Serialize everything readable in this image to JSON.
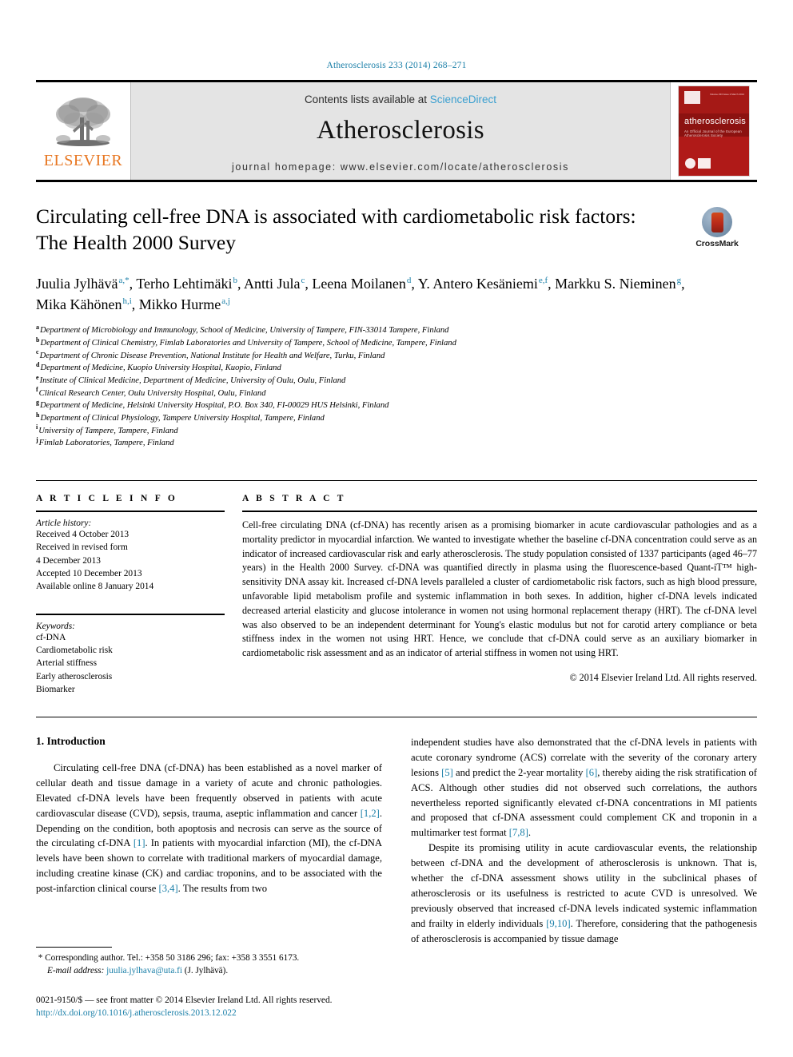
{
  "running_head": "Atherosclerosis 233 (2014) 268–271",
  "masthead": {
    "publisher_logo_label": "ELSEVIER",
    "contents_prefix": "Contents lists available at ",
    "contents_link": "ScienceDirect",
    "journal_name": "Atherosclerosis",
    "homepage": "journal homepage: www.elsevier.com/locate/atherosclerosis",
    "cover": {
      "title": "atherosclerosis",
      "subtitle": "An Official Journal of the European Atherosclerosis Society",
      "top_meta": "Volume 233  Issue 2  March 2014"
    }
  },
  "article": {
    "title": "Circulating cell-free DNA is associated with cardiometabolic risk factors: The Health 2000 Survey",
    "crossmark_label": "CrossMark",
    "authors": [
      {
        "name": "Juulia Jylhävä",
        "marks": "a,*",
        "sep": ", "
      },
      {
        "name": "Terho Lehtimäki",
        "marks": "b",
        "sep": ", "
      },
      {
        "name": "Antti Jula",
        "marks": "c",
        "sep": ", "
      },
      {
        "name": "Leena Moilanen",
        "marks": "d",
        "sep": ", "
      },
      {
        "name": "Y. Antero Kesäniemi",
        "marks": "e,f",
        "sep": ", "
      },
      {
        "name": "Markku S. Nieminen",
        "marks": "g",
        "sep": ", "
      },
      {
        "name": "Mika Kähönen",
        "marks": "h,i",
        "sep": ", "
      },
      {
        "name": "Mikko Hurme",
        "marks": "a,j",
        "sep": ""
      }
    ],
    "affiliations": [
      {
        "mark": "a",
        "text": "Department of Microbiology and Immunology, School of Medicine, University of Tampere, FIN-33014 Tampere, Finland"
      },
      {
        "mark": "b",
        "text": "Department of Clinical Chemistry, Fimlab Laboratories and University of Tampere, School of Medicine, Tampere, Finland"
      },
      {
        "mark": "c",
        "text": "Department of Chronic Disease Prevention, National Institute for Health and Welfare, Turku, Finland"
      },
      {
        "mark": "d",
        "text": "Department of Medicine, Kuopio University Hospital, Kuopio, Finland"
      },
      {
        "mark": "e",
        "text": "Institute of Clinical Medicine, Department of Medicine, University of Oulu, Oulu, Finland"
      },
      {
        "mark": "f",
        "text": "Clinical Research Center, Oulu University Hospital, Oulu, Finland"
      },
      {
        "mark": "g",
        "text": "Department of Medicine, Helsinki University Hospital, P.O. Box 340, FI-00029 HUS Helsinki, Finland"
      },
      {
        "mark": "h",
        "text": "Department of Clinical Physiology, Tampere University Hospital, Tampere, Finland"
      },
      {
        "mark": "i",
        "text": "University of Tampere, Tampere, Finland"
      },
      {
        "mark": "j",
        "text": "Fimlab Laboratories, Tampere, Finland"
      }
    ]
  },
  "article_info": {
    "heading": "A R T I C L E   I N F O",
    "history_label": "Article history:",
    "history": [
      "Received 4 October 2013",
      "Received in revised form",
      "4 December 2013",
      "Accepted 10 December 2013",
      "Available online 8 January 2014"
    ],
    "keywords_label": "Keywords:",
    "keywords": [
      "cf-DNA",
      "Cardiometabolic risk",
      "Arterial stiffness",
      "Early atherosclerosis",
      "Biomarker"
    ]
  },
  "abstract": {
    "heading": "A B S T R A C T",
    "text": "Cell-free circulating DNA (cf-DNA) has recently arisen as a promising biomarker in acute cardiovascular pathologies and as a mortality predictor in myocardial infarction. We wanted to investigate whether the baseline cf-DNA concentration could serve as an indicator of increased cardiovascular risk and early atherosclerosis. The study population consisted of 1337 participants (aged 46–77 years) in the Health 2000 Survey. cf-DNA was quantified directly in plasma using the fluorescence-based Quant-iT™ high-sensitivity DNA assay kit. Increased cf-DNA levels paralleled a cluster of cardiometabolic risk factors, such as high blood pressure, unfavorable lipid metabolism profile and systemic inflammation in both sexes. In addition, higher cf-DNA levels indicated decreased arterial elasticity and glucose intolerance in women not using hormonal replacement therapy (HRT). The cf-DNA level was also observed to be an independent determinant for Young's elastic modulus but not for carotid artery compliance or beta stiffness index in the women not using HRT. Hence, we conclude that cf-DNA could serve as an auxiliary biomarker in cardiometabolic risk assessment and as an indicator of arterial stiffness in women not using HRT.",
    "copyright": "© 2014 Elsevier Ireland Ltd. All rights reserved."
  },
  "introduction": {
    "section_title": "1.  Introduction",
    "left_paragraph_1": "Circulating cell-free DNA (cf-DNA) has been established as a novel marker of cellular death and tissue damage in a variety of acute and chronic pathologies. Elevated cf-DNA levels have been frequently observed in patients with acute cardiovascular disease (CVD), sepsis, trauma, aseptic inflammation and cancer ",
    "left_cite_1": "[1,2]",
    "left_paragraph_2": ". Depending on the condition, both apoptosis and necrosis can serve as the source of the circulating cf-DNA ",
    "left_cite_2": "[1]",
    "left_paragraph_3": ". In patients with myocardial infarction (MI), the cf-DNA levels have been shown to correlate with traditional markers of myocardial damage, including creatine kinase (CK) and cardiac troponins, and to be associated with the post-infarction clinical course ",
    "left_cite_3": "[3,4]",
    "left_paragraph_4": ". The results from two",
    "right_paragraph_1": "independent studies have also demonstrated that the cf-DNA levels in patients with acute coronary syndrome (ACS) correlate with the severity of the coronary artery lesions ",
    "right_cite_1": "[5]",
    "right_paragraph_2": " and predict the 2-year mortality ",
    "right_cite_2": "[6]",
    "right_paragraph_3": ", thereby aiding the risk stratification of ACS. Although other studies did not observed such correlations, the authors nevertheless reported significantly elevated cf-DNA concentrations in MI patients and proposed that cf-DNA assessment could complement CK and troponin in a multimarker test format ",
    "right_cite_3": "[7,8]",
    "right_paragraph_4": ".",
    "right_paragraph_5": "Despite its promising utility in acute cardiovascular events, the relationship between cf-DNA and the development of atherosclerosis is unknown. That is, whether the cf-DNA assessment shows utility in the subclinical phases of atherosclerosis or its usefulness is restricted to acute CVD is unresolved. We previously observed that increased cf-DNA levels indicated systemic inflammation and frailty in elderly individuals ",
    "right_cite_4": "[9,10]",
    "right_paragraph_6": ". Therefore, considering that the pathogenesis of atherosclerosis is accompanied by tissue damage"
  },
  "footer": {
    "corresponding_marker": "*",
    "corresponding_text": "Corresponding author. Tel.: +358 50 3186 296; fax: +358 3 3551 6173.",
    "email_label": "E-mail address:",
    "email": "juulia.jylhava@uta.fi",
    "email_owner": "(J. Jylhävä).",
    "frontmatter": "0021-9150/$ — see front matter © 2014 Elsevier Ireland Ltd. All rights reserved.",
    "doi": "http://dx.doi.org/10.1016/j.atherosclerosis.2013.12.022"
  }
}
